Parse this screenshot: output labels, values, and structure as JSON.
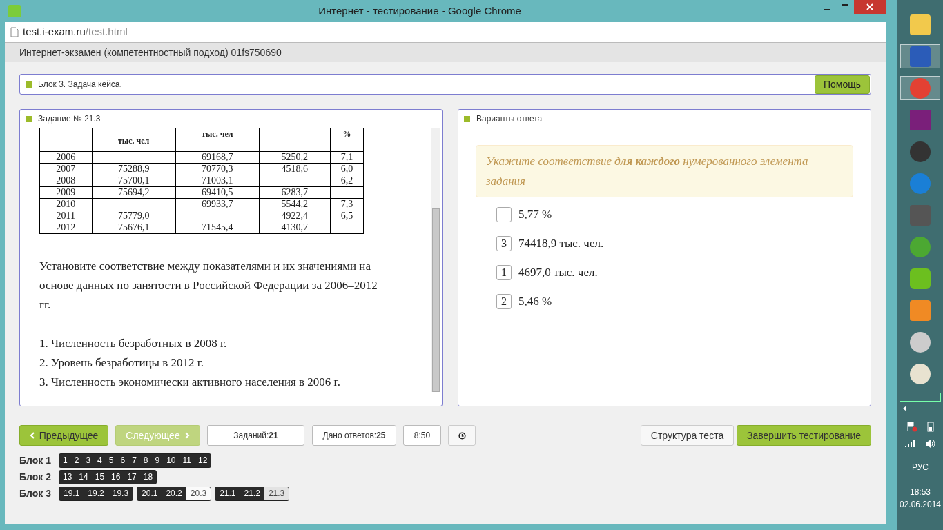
{
  "window": {
    "title": "Интернет - тестирование - Google Chrome"
  },
  "address_bar": {
    "host": "test.i-exam.ru",
    "path": "/test.html"
  },
  "page_header": "Интернет-экзамен (компетентностный подход) 01fs750690",
  "block_bar": {
    "title": "Блок 3. Задача кейса.",
    "help_button": "Помощь"
  },
  "task_panel": {
    "title": "Задание № 21.3",
    "table": {
      "header": {
        "column_2": "тыс. чел",
        "column_3": "тыс. чел",
        "column_5": "%"
      },
      "rows": [
        [
          "2006",
          "",
          "69168,7",
          "5250,2",
          "7,1"
        ],
        [
          "2007",
          "75288,9",
          "70770,3",
          "4518,6",
          "6,0"
        ],
        [
          "2008",
          "75700,1",
          "71003,1",
          "",
          "6,2"
        ],
        [
          "2009",
          "75694,2",
          "69410,5",
          "6283,7",
          ""
        ],
        [
          "2010",
          "",
          "69933,7",
          "5544,2",
          "7,3"
        ],
        [
          "2011",
          "75779,0",
          "",
          "4922,4",
          "6,5"
        ],
        [
          "2012",
          "75676,1",
          "71545,4",
          "4130,7",
          ""
        ]
      ]
    },
    "question": "Установите соответствие между показателями и их значениями на основе данных по занятости в Российской Федерации за 2006–2012 гг.",
    "items": [
      "1. Численность безработных в 2008 г.",
      "2. Уровень безработицы в 2012 г.",
      "3. Численность экономически активного населения в 2006 г."
    ]
  },
  "answer_panel": {
    "title": "Варианты ответа",
    "hint": "Укажите соответствие **для каждого** нумерованного элемента задания",
    "options": [
      {
        "text": "5,77 %"
      },
      {
        "number": "3",
        "text": "74418,9 тыс. чел."
      },
      {
        "number": "1",
        "text": "4697,0 тыс. чел."
      },
      {
        "number": "2",
        "text": "5,46 %"
      }
    ]
  },
  "toolbar": {
    "prev": "Предыдущее",
    "next": "Следующее",
    "next_disabled": true,
    "tasks_label": "Заданий:",
    "tasks_count": "21",
    "answers_label": "Дано ответов:",
    "answers_count": "25",
    "timer": "8:50",
    "structure": "Структура теста",
    "finish": "Завершить тестирование"
  },
  "blocks": [
    {
      "label": "Блок 1",
      "groups": [
        [
          {
            "n": "1",
            "answered": true,
            "selected": false
          },
          {
            "n": "2",
            "answered": true,
            "selected": false
          },
          {
            "n": "3",
            "answered": true,
            "selected": false
          },
          {
            "n": "4",
            "answered": true,
            "selected": false
          },
          {
            "n": "5",
            "answered": true,
            "selected": false
          },
          {
            "n": "6",
            "answered": true,
            "selected": false
          },
          {
            "n": "7",
            "answered": true,
            "selected": false
          },
          {
            "n": "8",
            "answered": true,
            "selected": false
          },
          {
            "n": "9",
            "answered": true,
            "selected": false
          },
          {
            "n": "10",
            "answered": true,
            "selected": false
          },
          {
            "n": "11",
            "answered": true,
            "selected": false
          },
          {
            "n": "12",
            "answered": true,
            "selected": false
          }
        ]
      ]
    },
    {
      "label": "Блок 2",
      "groups": [
        [
          {
            "n": "13",
            "answered": true,
            "selected": false
          },
          {
            "n": "14",
            "answered": true,
            "selected": false
          },
          {
            "n": "15",
            "answered": true,
            "selected": false
          },
          {
            "n": "16",
            "answered": true,
            "selected": false
          },
          {
            "n": "17",
            "answered": true,
            "selected": false
          },
          {
            "n": "18",
            "answered": true,
            "selected": false
          }
        ]
      ]
    },
    {
      "label": "Блок 3",
      "groups": [
        [
          {
            "n": "19.1",
            "answered": true,
            "selected": false
          },
          {
            "n": "19.2",
            "answered": true,
            "selected": false
          },
          {
            "n": "19.3",
            "answered": true,
            "selected": false
          }
        ],
        [
          {
            "n": "20.1",
            "answered": true,
            "selected": false
          },
          {
            "n": "20.2",
            "answered": true,
            "selected": false
          },
          {
            "n": "20.3",
            "answered": false,
            "selected": false
          }
        ],
        [
          {
            "n": "21.1",
            "answered": true,
            "selected": false
          },
          {
            "n": "21.2",
            "answered": true,
            "selected": false
          },
          {
            "n": "21.3",
            "answered": false,
            "selected": true
          }
        ]
      ]
    }
  ],
  "taskbar": {
    "language": "РУС",
    "time": "18:53",
    "date": "02.06.2014"
  }
}
